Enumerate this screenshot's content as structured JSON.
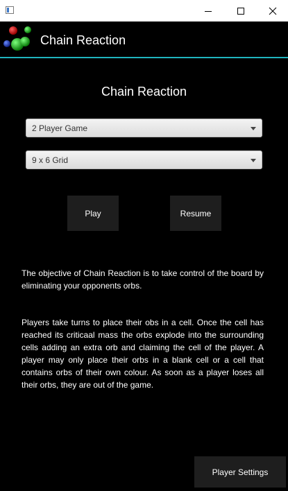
{
  "window": {
    "minimize_icon": "minimize-icon",
    "maximize_icon": "maximize-icon",
    "close_icon": "close-icon"
  },
  "header": {
    "app_title": "Chain Reaction",
    "logo_icon": "orbs-logo-icon"
  },
  "main": {
    "title": "Chain Reaction",
    "players_select": {
      "value": "2 Player Game"
    },
    "grid_select": {
      "value": "9 x 6 Grid"
    },
    "play_label": "Play",
    "resume_label": "Resume",
    "paragraph_1": "The objective of Chain Reaction is to take control of the board by eliminating your opponents orbs.",
    "paragraph_2": "Players take turns to place their obs in a cell. Once the cell has reached its criticaal mass the orbs explode into the surrounding cells adding an extra orb and claiming the cell of the player. A player may only place their orbs in a blank cell or a cell that contains orbs of their own colour. As soon as a player loses all their orbs, they are out of the game."
  },
  "footer": {
    "settings_label": "Player Settings"
  },
  "colors": {
    "accent_line": "#1fb5bf",
    "background": "#000000",
    "button_bg": "#1e1e1e"
  }
}
